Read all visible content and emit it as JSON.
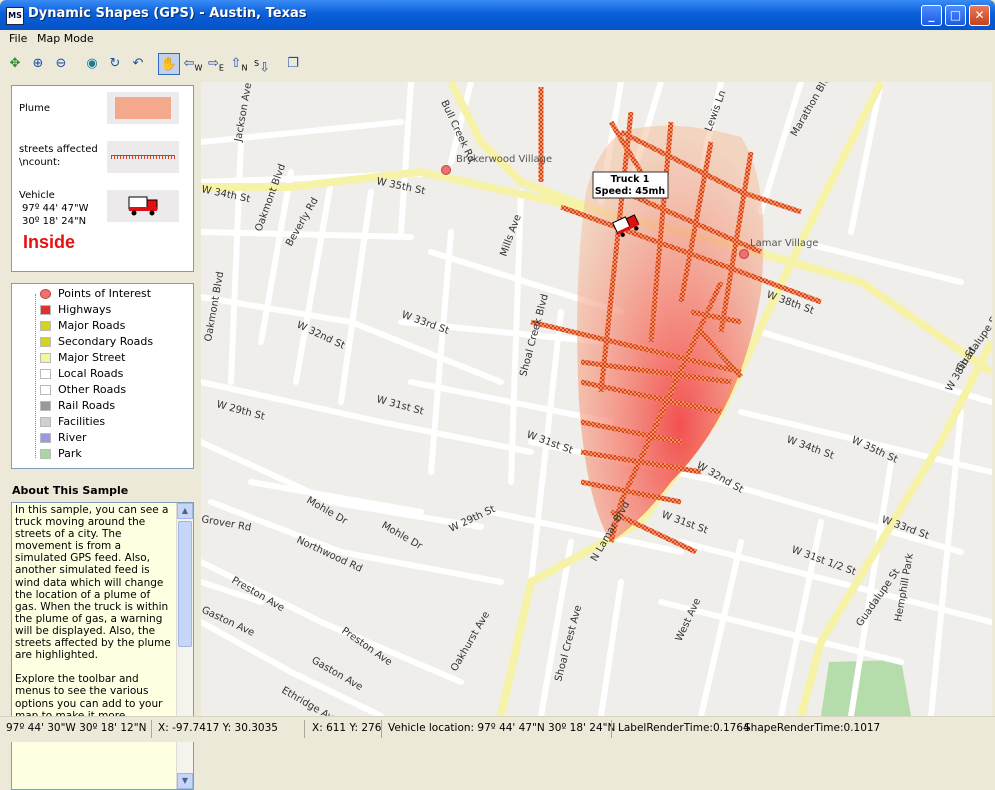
{
  "window": {
    "title": "Dynamic Shapes (GPS)  -  Austin, Texas",
    "app_icon": "MS",
    "min": "_",
    "max": "□",
    "close": "✕"
  },
  "menu": {
    "file": "File",
    "map_mode": "Map Mode"
  },
  "toolbar": {
    "icons": [
      "select-icon",
      "zoom-in-icon",
      "zoom-out-icon",
      "globe-icon",
      "refresh-icon",
      "undo-icon",
      "pan-hand-icon",
      "pan-west-icon",
      "pan-east-icon",
      "pan-north-icon",
      "pan-south-icon",
      "layers-icon"
    ],
    "west": "W",
    "east": "E",
    "north": "N",
    "south": "S"
  },
  "legend_top": {
    "plume_label": "Plume",
    "streets_label": "streets affected\\ncount:",
    "vehicle_label": "Vehicle",
    "vehicle_lon": "97º 44' 47\"W",
    "vehicle_lat": "30º 18' 24\"N",
    "status": "Inside",
    "plume_color": "#f4a98c",
    "streets_color": "#d93a1a"
  },
  "legend_layers": [
    {
      "label": "Points of Interest",
      "color": "#f07070"
    },
    {
      "label": "Highways",
      "color": "#e03030"
    },
    {
      "label": "Major Roads",
      "color": "#d4d41e"
    },
    {
      "label": "Secondary Roads",
      "color": "#d4d41e"
    },
    {
      "label": "Major Street",
      "color": "#f5f5a0"
    },
    {
      "label": "Local Roads",
      "color": "#ffffff"
    },
    {
      "label": "Other Roads",
      "color": "#ffffff"
    },
    {
      "label": "Rail Roads",
      "color": "#999999"
    },
    {
      "label": "Facilities",
      "color": "#d0d0d0"
    },
    {
      "label": "River",
      "color": "#9999dd"
    },
    {
      "label": "Park",
      "color": "#a8d8a0"
    }
  ],
  "about": {
    "title": "About This Sample",
    "text": "In this sample, you can see a truck moving around the streets of a city. The movement is from a simulated GPS feed. Also, another simulated feed is wind data which will change the location of a plume of gas. When the truck is within the plume of gas, a warning will be displayed. Also, the streets affected by the plume are highlighted.\n\nExplore the toolbar and menus to see the various options you can add to your map to make it more"
  },
  "map": {
    "truck_callout_line1": "Truck 1",
    "truck_callout_line2": "Speed: 45mh",
    "places": [
      "Brykerwood Village",
      "Lamar Village"
    ],
    "streets": [
      "Jackson Ave",
      "Bull Creek Rd",
      "W 35th St",
      "W 34th St",
      "Oakmont Blvd",
      "Beverly Rd",
      "Mills Ave",
      "W 33rd St",
      "W 32nd St",
      "Oakmont Blvd",
      "W 29th St",
      "W 31st St",
      "Shoal Creek Blvd",
      "W 38th St",
      "W 31st St",
      "W 32nd St",
      "W 34th St",
      "W 35th St",
      "W 33rd St",
      "W 31st St",
      "W 31st 1/2 St",
      "Guadalupe St",
      "Mohle Dr",
      "Mohle Dr",
      "Northwood Rd",
      "W 29th St",
      "Grover Rd",
      "Preston Ave",
      "Gaston Ave",
      "Preston Ave",
      "Gaston Ave",
      "Ethridge Ave",
      "Shoal Crest Ave",
      "Oakhurst Ave",
      "West Ave",
      "Hemphill Park",
      "N Lamar Blvd",
      "Lewis Ln",
      "Marathon Blvd",
      "W 38th St",
      "Guadalupe St"
    ]
  },
  "status": {
    "coords_dms": "97º 44' 30\"W  30º 18' 12\"N",
    "coords_xy": "X: -97.7417  Y: 30.3035",
    "pixel": "X: 611  Y: 276",
    "vehicle": "Vehicle location: 97º 44' 47\"N  30º 18' 24\"N",
    "label_time": "LabelRenderTime:0.1764",
    "shape_time": "ShapeRenderTime:0.1017"
  }
}
